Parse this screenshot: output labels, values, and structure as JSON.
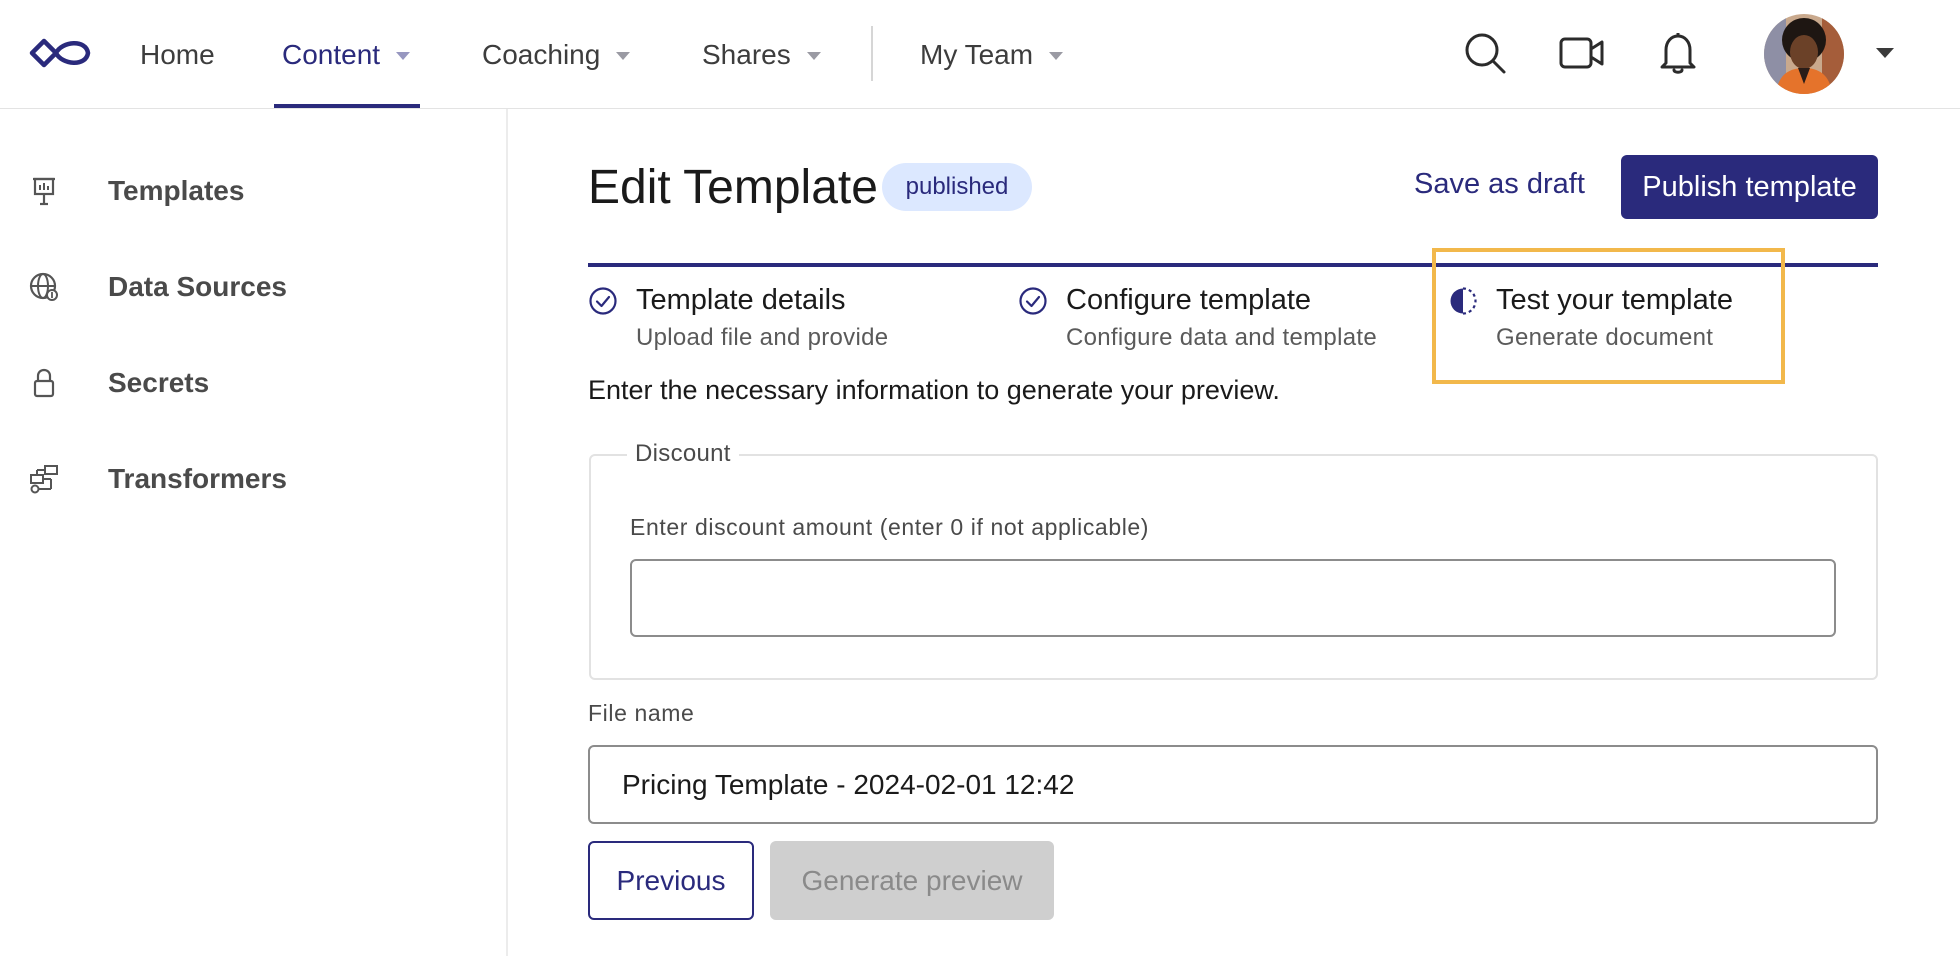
{
  "nav": {
    "logo_icon": "infinity-logo-icon",
    "items": [
      {
        "label": "Home",
        "has_dropdown": false
      },
      {
        "label": "Content",
        "has_dropdown": true,
        "active": true
      },
      {
        "label": "Coaching",
        "has_dropdown": true
      },
      {
        "label": "Shares",
        "has_dropdown": true
      },
      {
        "label": "My Team",
        "has_dropdown": true
      }
    ],
    "icons": [
      "search-icon",
      "video-camera-icon",
      "bell-icon"
    ],
    "accent_color": "#2a2a7c"
  },
  "sidebar": {
    "items": [
      {
        "label": "Templates",
        "icon": "presentation-board-icon"
      },
      {
        "label": "Data Sources",
        "icon": "globe-icon"
      },
      {
        "label": "Secrets",
        "icon": "lock-icon"
      },
      {
        "label": "Transformers",
        "icon": "flow-icon"
      }
    ]
  },
  "header": {
    "title": "Edit Template",
    "badge": "published",
    "save_draft_label": "Save as draft",
    "publish_label": "Publish template"
  },
  "stepper": {
    "steps": [
      {
        "title": "Template details",
        "subtitle": "Upload file and provide",
        "status": "complete",
        "icon": "check-circle-icon"
      },
      {
        "title": "Configure template",
        "subtitle": "Configure data and template",
        "status": "complete",
        "icon": "check-circle-icon"
      },
      {
        "title": "Test your template",
        "subtitle": "Generate document",
        "status": "in-progress",
        "icon": "half-circle-icon"
      }
    ],
    "highlight_color": "#f2b84b"
  },
  "form": {
    "instructions": "Enter the necessary information to generate your preview.",
    "discount": {
      "legend": "Discount",
      "label": "Enter discount amount (enter 0 if not applicable)",
      "value": "",
      "placeholder": ""
    },
    "file_name": {
      "label": "File name",
      "value": "Pricing Template - 2024-02-01 12:42"
    },
    "previous_label": "Previous",
    "generate_label": "Generate preview"
  }
}
